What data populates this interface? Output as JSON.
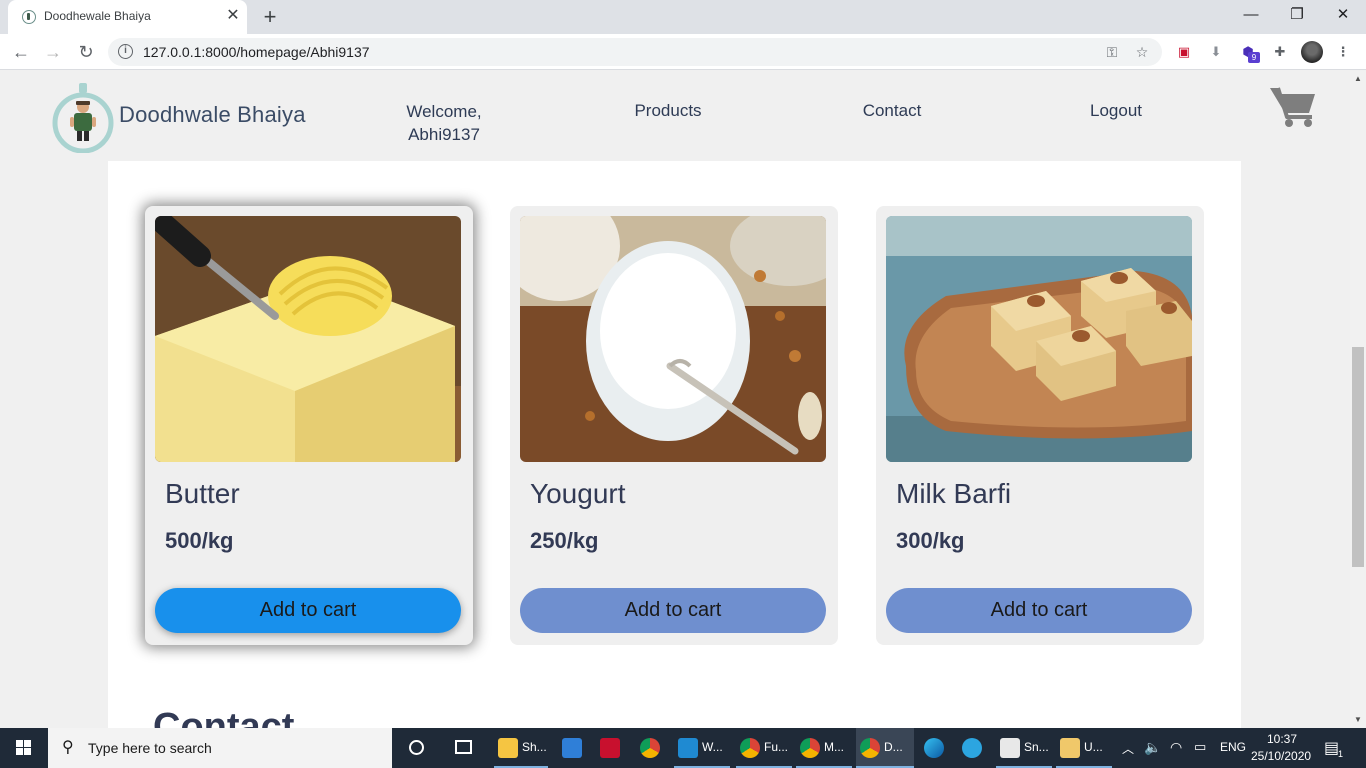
{
  "browser": {
    "tab_title": "Doodhewale Bhaiya",
    "url": "127.0.0.1:8000/homepage/Abhi9137",
    "extension_badge": "9"
  },
  "site": {
    "logo_text": "Doodhwale Bhaiya",
    "nav": {
      "welcome_line1": "Welcome,",
      "welcome_line2": "Abhi9137",
      "products": "Products",
      "contact": "Contact",
      "logout": "Logout"
    },
    "products": [
      {
        "name": "Butter",
        "price": "500/kg",
        "button": "Add to cart",
        "image": "butter-photo"
      },
      {
        "name": "Yougurt",
        "price": "250/kg",
        "button": "Add to cart",
        "image": "yogurt-photo"
      },
      {
        "name": "Milk Barfi",
        "price": "300/kg",
        "button": "Add to cart",
        "image": "barfi-photo"
      }
    ],
    "contact_heading": "Contact",
    "colors": {
      "button_hover": "#1890ec",
      "button_default": "#6f8fcf",
      "text_dark": "#323a55"
    }
  },
  "taskbar": {
    "search_placeholder": "Type here to search",
    "items": [
      {
        "label": "Sh...",
        "icon": "file-explorer-icon"
      },
      {
        "label": "",
        "icon": "mail-icon"
      },
      {
        "label": "",
        "icon": "mcafee-icon"
      },
      {
        "label": "",
        "icon": "chrome-icon"
      },
      {
        "label": "W...",
        "icon": "vscode-icon"
      },
      {
        "label": "Fu...",
        "icon": "chrome-profile-icon"
      },
      {
        "label": "M...",
        "icon": "chrome-profile-icon"
      },
      {
        "label": "D...",
        "icon": "chrome-profile-icon"
      },
      {
        "label": "",
        "icon": "edge-icon"
      },
      {
        "label": "",
        "icon": "telegram-icon"
      },
      {
        "label": "Sn...",
        "icon": "snip-icon"
      },
      {
        "label": "U...",
        "icon": "paint-icon"
      }
    ],
    "language": "ENG",
    "time": "10:37",
    "date": "25/10/2020",
    "notification_count": "1"
  }
}
